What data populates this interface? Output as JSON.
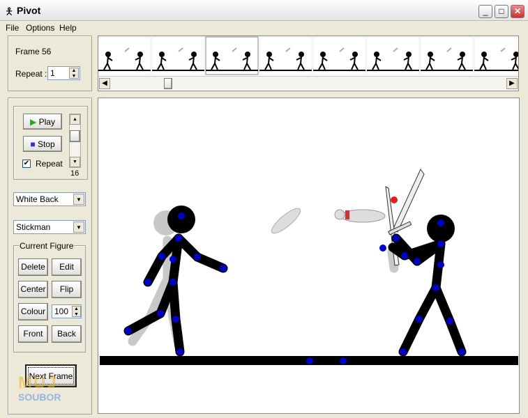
{
  "window": {
    "title": "Pivot",
    "icon": "stickman-icon",
    "minimize": "minimize-icon",
    "maximize": "maximize-icon",
    "close": "close-icon"
  },
  "menu": [
    "File",
    "Options",
    "Help"
  ],
  "frame_panel": {
    "frame_label": "Frame 56",
    "repeat_label": "Repeat :",
    "repeat_value": "1"
  },
  "playback": {
    "play": "Play",
    "stop": "Stop",
    "repeat": "Repeat",
    "repeat_checked": true,
    "speed": "16"
  },
  "background_select": "White Back",
  "figure_select": "Stickman",
  "current_figure": {
    "title": "Current Figure",
    "delete": "Delete",
    "edit": "Edit",
    "center": "Center",
    "flip": "Flip",
    "colour": "Colour",
    "opacity": "100",
    "front": "Front",
    "back": "Back"
  },
  "next_frame": "Next Frame",
  "watermark": "MUJ SOUBOR",
  "colors": {
    "joint": "#0000cc",
    "figure": "#000000",
    "shadow": "#c8c8c8",
    "selected_joint": "#e02020"
  }
}
